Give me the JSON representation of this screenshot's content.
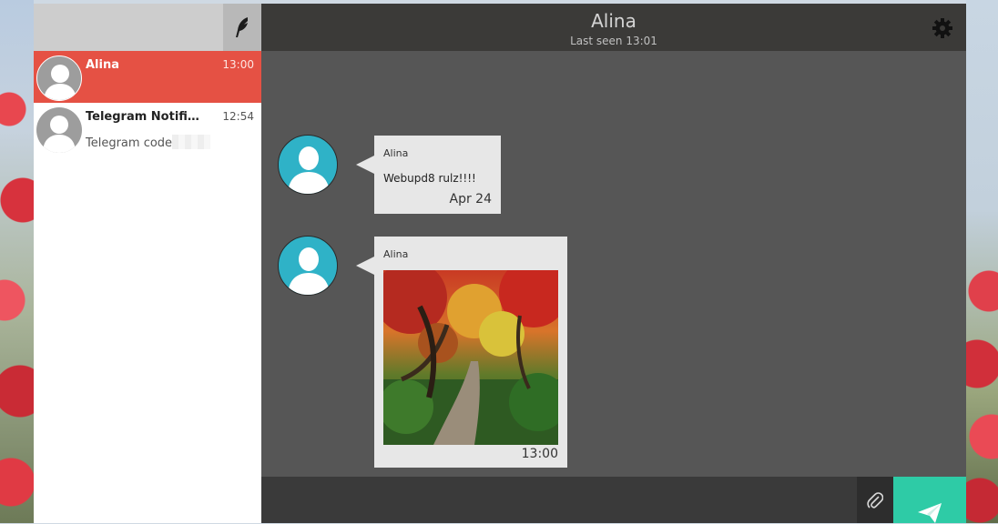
{
  "sidebar": {
    "chats": [
      {
        "name": "Alina",
        "time": "13:00",
        "preview": ""
      },
      {
        "name": "Telegram Notificati...",
        "time": "12:54",
        "preview": "Telegram code"
      }
    ]
  },
  "header": {
    "title": "Alina",
    "status": "Last seen 13:01"
  },
  "messages": [
    {
      "sender": "Alina",
      "text": "Webupd8 rulz!!!!",
      "time": "Apr 24"
    },
    {
      "sender": "Alina",
      "time": "13:00"
    }
  ],
  "icons": {
    "compose": "feather-icon",
    "settings": "gear-icon",
    "attach": "paperclip-icon",
    "send": "paper-plane-icon"
  },
  "colors": {
    "active_chat": "#e55144",
    "avatar_blue": "#2fb2c7",
    "send_button": "#2ecba6"
  }
}
